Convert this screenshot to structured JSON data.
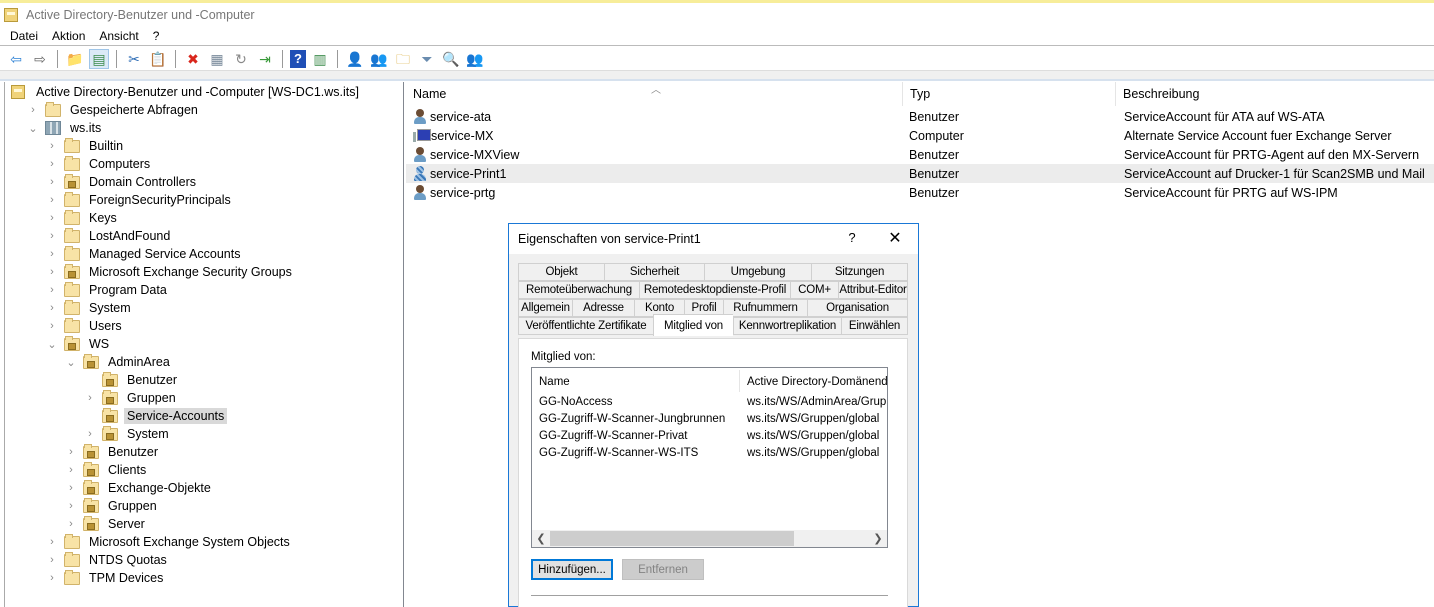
{
  "window": {
    "title": "Active Directory-Benutzer und -Computer"
  },
  "menu": [
    "Datei",
    "Aktion",
    "Ansicht",
    "?"
  ],
  "toolbar": {
    "buttons": [
      {
        "name": "back-icon",
        "glyph": "⇦",
        "color": "#2a7fd4"
      },
      {
        "name": "forward-icon",
        "glyph": "⇨",
        "color": "#666666"
      },
      {
        "name": "up-folder-icon",
        "glyph": "📁",
        "color": "#d8a730"
      },
      {
        "name": "show-hide-console-tree-icon",
        "glyph": "▤",
        "color": "#3a8a4a"
      },
      {
        "name": "cut-icon",
        "glyph": "✂",
        "color": "#2a6ab4"
      },
      {
        "name": "paste-icon",
        "glyph": "📋",
        "color": "#444444"
      },
      {
        "name": "delete-icon",
        "glyph": "✖",
        "color": "#d9261c"
      },
      {
        "name": "properties-icon",
        "glyph": "▦",
        "color": "#778899"
      },
      {
        "name": "refresh-icon",
        "glyph": "↻",
        "color": "#888888"
      },
      {
        "name": "export-list-icon",
        "glyph": "⇥",
        "color": "#3a9a3a"
      },
      {
        "name": "help-icon",
        "glyph": "?",
        "color": "#ffffff"
      },
      {
        "name": "show-action-pane-icon",
        "glyph": "▥",
        "color": "#3a8a4a"
      },
      {
        "name": "new-user-icon",
        "glyph": "👤",
        "color": "#3b6ea5"
      },
      {
        "name": "new-group-icon",
        "glyph": "👥",
        "color": "#3b6ea5"
      },
      {
        "name": "new-ou-icon",
        "glyph": "🗀",
        "color": "#d8a730"
      },
      {
        "name": "filter-icon",
        "glyph": "⏷",
        "color": "#6a8caf"
      },
      {
        "name": "find-icon",
        "glyph": "🔍",
        "color": "#c9a030"
      },
      {
        "name": "add-to-group-icon",
        "glyph": "👥",
        "color": "#3a9a3a"
      }
    ]
  },
  "tree": {
    "items": [
      {
        "label": "Active Directory-Benutzer und -Computer [WS-DC1.ws.its]",
        "level": 0,
        "chevron": "",
        "icon": "root"
      },
      {
        "label": "Gespeicherte Abfragen",
        "level": 1,
        "chevron": "›",
        "icon": "folder"
      },
      {
        "label": "ws.its",
        "level": 1,
        "chevron": "⌄",
        "icon": "domain"
      },
      {
        "label": "Builtin",
        "level": 2,
        "chevron": "›",
        "icon": "folder"
      },
      {
        "label": "Computers",
        "level": 2,
        "chevron": "›",
        "icon": "folder"
      },
      {
        "label": "Domain Controllers",
        "level": 2,
        "chevron": "›",
        "icon": "ou"
      },
      {
        "label": "ForeignSecurityPrincipals",
        "level": 2,
        "chevron": "›",
        "icon": "folder"
      },
      {
        "label": "Keys",
        "level": 2,
        "chevron": "›",
        "icon": "folder"
      },
      {
        "label": "LostAndFound",
        "level": 2,
        "chevron": "›",
        "icon": "folder"
      },
      {
        "label": "Managed Service Accounts",
        "level": 2,
        "chevron": "›",
        "icon": "folder"
      },
      {
        "label": "Microsoft Exchange Security Groups",
        "level": 2,
        "chevron": "›",
        "icon": "ou"
      },
      {
        "label": "Program Data",
        "level": 2,
        "chevron": "›",
        "icon": "folder"
      },
      {
        "label": "System",
        "level": 2,
        "chevron": "›",
        "icon": "folder"
      },
      {
        "label": "Users",
        "level": 2,
        "chevron": "›",
        "icon": "folder"
      },
      {
        "label": "WS",
        "level": 2,
        "chevron": "⌄",
        "icon": "ou"
      },
      {
        "label": "AdminArea",
        "level": 3,
        "chevron": "⌄",
        "icon": "ou"
      },
      {
        "label": "Benutzer",
        "level": 4,
        "chevron": "",
        "icon": "ou"
      },
      {
        "label": "Gruppen",
        "level": 4,
        "chevron": "›",
        "icon": "ou"
      },
      {
        "label": "Service-Accounts",
        "level": 4,
        "chevron": "",
        "icon": "ou",
        "selected": true
      },
      {
        "label": "System",
        "level": 4,
        "chevron": "›",
        "icon": "ou"
      },
      {
        "label": "Benutzer",
        "level": 3,
        "chevron": "›",
        "icon": "ou"
      },
      {
        "label": "Clients",
        "level": 3,
        "chevron": "›",
        "icon": "ou"
      },
      {
        "label": "Exchange-Objekte",
        "level": 3,
        "chevron": "›",
        "icon": "ou"
      },
      {
        "label": "Gruppen",
        "level": 3,
        "chevron": "›",
        "icon": "ou"
      },
      {
        "label": "Server",
        "level": 3,
        "chevron": "›",
        "icon": "ou"
      },
      {
        "label": "Microsoft Exchange System Objects",
        "level": 2,
        "chevron": "›",
        "icon": "folder"
      },
      {
        "label": "NTDS Quotas",
        "level": 2,
        "chevron": "›",
        "icon": "folder"
      },
      {
        "label": "TPM Devices",
        "level": 2,
        "chevron": "›",
        "icon": "folder"
      }
    ]
  },
  "list": {
    "columns": [
      "Name",
      "Typ",
      "Beschreibung"
    ],
    "sort_indicator": "^",
    "rows": [
      {
        "name": "service-ata",
        "type": "Benutzer",
        "description": "ServiceAccount für ATA auf WS-ATA",
        "icon": "user"
      },
      {
        "name": "service-MX",
        "type": "Computer",
        "description": "Alternate Service Account fuer Exchange Server",
        "icon": "computer"
      },
      {
        "name": "service-MXView",
        "type": "Benutzer",
        "description": "ServiceAccount für PRTG-Agent auf den MX-Servern",
        "icon": "user"
      },
      {
        "name": "service-Print1",
        "type": "Benutzer",
        "description": "ServiceAccount auf Drucker-1 für Scan2SMB und Mail",
        "icon": "user-alt",
        "highlighted": true
      },
      {
        "name": "service-prtg",
        "type": "Benutzer",
        "description": "ServiceAccount für PRTG auf WS-IPM",
        "icon": "user"
      }
    ]
  },
  "dialog": {
    "title": "Eigenschaften von service-Print1",
    "help": "?",
    "close": "✕",
    "tab_rows": [
      [
        "Objekt",
        "Sicherheit",
        "Umgebung",
        "Sitzungen"
      ],
      [
        "Remoteüberwachung",
        "Remotedesktopdienste-Profil",
        "COM+",
        "Attribut-Editor"
      ],
      [
        "Allgemein",
        "Adresse",
        "Konto",
        "Profil",
        "Rufnummern",
        "Organisation"
      ],
      [
        "Veröffentlichte Zertifikate",
        "Mitglied von",
        "Kennwortreplikation",
        "Einwählen"
      ]
    ],
    "active_tab": "Mitglied von",
    "member_of_label": "Mitglied von:",
    "member_columns": [
      "Name",
      "Active Directory-Domänendienste-Ordner"
    ],
    "members": [
      {
        "name": "GG-NoAccess",
        "folder": "ws.its/WS/AdminArea/Gruppen"
      },
      {
        "name": "GG-Zugriff-W-Scanner-Jungbrunnen",
        "folder": "ws.its/WS/Gruppen/global"
      },
      {
        "name": "GG-Zugriff-W-Scanner-Privat",
        "folder": "ws.its/WS/Gruppen/global"
      },
      {
        "name": "GG-Zugriff-W-Scanner-WS-ITS",
        "folder": "ws.its/WS/Gruppen/global"
      }
    ],
    "add_button": "Hinzufügen...",
    "remove_button": "Entfernen",
    "remove_enabled": false
  }
}
